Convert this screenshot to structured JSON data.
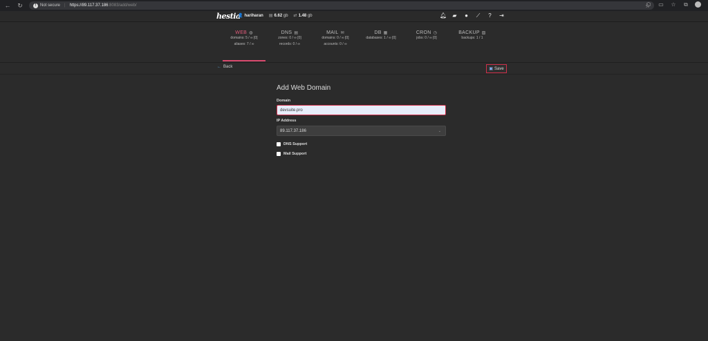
{
  "browser": {
    "security_label": "Not secure",
    "url_scheme_host": "https://89.117.37.186",
    "url_path": ":8083/add/web/"
  },
  "app": {
    "logo": "hestia",
    "user": "hariharan",
    "disk": "6.62",
    "disk_unit": "gb",
    "bandwidth": "1.48",
    "bandwidth_unit": "gb"
  },
  "tabs": [
    {
      "label": "WEB",
      "stat1": "domains: 5 / ∞ [0]",
      "stat2": "aliases: 7 / ∞",
      "active": true
    },
    {
      "label": "DNS",
      "stat1": "zones: 0 / ∞ [0]",
      "stat2": "records: 0 / ∞",
      "active": false
    },
    {
      "label": "MAIL",
      "stat1": "domains: 0 / ∞ [0]",
      "stat2": "accounts: 0 / ∞",
      "active": false
    },
    {
      "label": "DB",
      "stat1": "databases: 1 / ∞ [0]",
      "stat2": "",
      "active": false
    },
    {
      "label": "CRON",
      "stat1": "jobs: 0 / ∞ [0]",
      "stat2": "",
      "active": false
    },
    {
      "label": "BACKUP",
      "stat1": "backups: 1 / 1",
      "stat2": "",
      "active": false
    }
  ],
  "toolbar": {
    "back_label": "Back",
    "save_label": "Save"
  },
  "form": {
    "title": "Add Web Domain",
    "domain_label": "Domain",
    "domain_value": "devsuite.pro",
    "ip_label": "IP Address",
    "ip_value": "89.117.37.186",
    "dns_support_label": "DNS Support",
    "mail_support_label": "Mail Support"
  },
  "colors": {
    "accent": "#d94a6e",
    "highlight_border": "#d0304a",
    "background": "#2b2b2b"
  }
}
